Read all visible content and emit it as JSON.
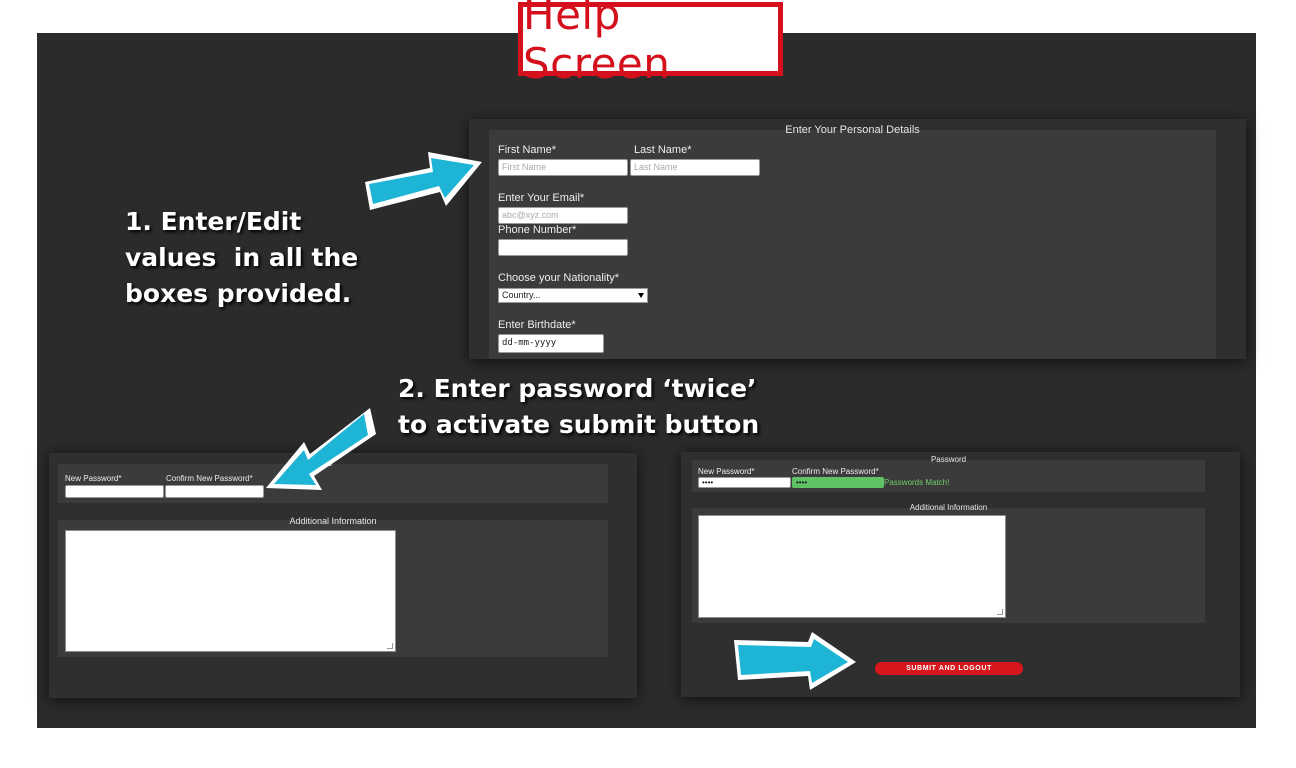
{
  "title": "Help Screen",
  "instructions": {
    "step1": [
      "1. Enter/Edit",
      "values  in all the",
      "boxes provided."
    ],
    "step2": [
      "2. Enter password ‘twice’",
      "to activate submit button"
    ]
  },
  "personal": {
    "heading": "Enter Your Personal Details",
    "first_name_label": "First Name*",
    "first_name_placeholder": "First Name",
    "last_name_label": "Last Name*",
    "last_name_placeholder": "Last Name",
    "email_label": "Enter Your Email*",
    "email_placeholder": "abc@xyz.com",
    "phone_label": "Phone Number*",
    "phone_value": "",
    "nationality_label": "Choose your Nationality*",
    "nationality_value": "Country...",
    "birthdate_label": "Enter Birthdate*",
    "birthdate_value": "dd-mm-yyyy"
  },
  "password_left": {
    "heading_fragment": "ord",
    "new_label": "New Password*",
    "confirm_label": "Confirm New Password*",
    "new_value": "",
    "confirm_value": ""
  },
  "additional_left": {
    "heading": "Additional Information"
  },
  "password_right": {
    "heading": "Password",
    "new_label": "New Password*",
    "confirm_label": "Confirm New Password*",
    "new_value": "••••",
    "confirm_value": "••••",
    "match_text": "Passwords Match!"
  },
  "additional_right": {
    "heading": "Additional Information"
  },
  "submit_label": "SUBMIT AND LOGOUT",
  "colors": {
    "title_red": "#d4101c",
    "arrow_cyan": "#1eb4d6",
    "match_green": "#5fc264",
    "submit_red": "#d8161d"
  },
  "icons": [
    "arrow-right-icon",
    "arrow-down-left-icon",
    "dropdown-caret-icon"
  ]
}
